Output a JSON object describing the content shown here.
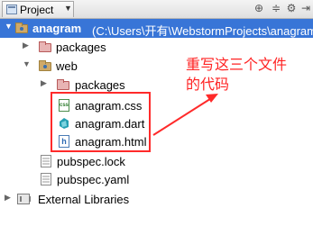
{
  "panel": {
    "tab_label": "Project"
  },
  "tree": {
    "root": {
      "name": "anagram",
      "path": "(C:\\Users\\开有\\WebstormProjects\\anagram"
    },
    "root_packages": "packages",
    "web": "web",
    "web_packages": "packages",
    "files": [
      "anagram.css",
      "anagram.dart",
      "anagram.html"
    ],
    "pubspec_lock": "pubspec.lock",
    "pubspec_yaml": "pubspec.yaml",
    "external_libraries": "External Libraries"
  },
  "annotation": {
    "line1": "重写这三个文件",
    "line2": "的代码",
    "color": "#ff2222"
  },
  "icons": {
    "folder": "folder-icon",
    "css": "css-file-icon",
    "dart": "dart-file-icon",
    "html": "html-file-icon"
  }
}
